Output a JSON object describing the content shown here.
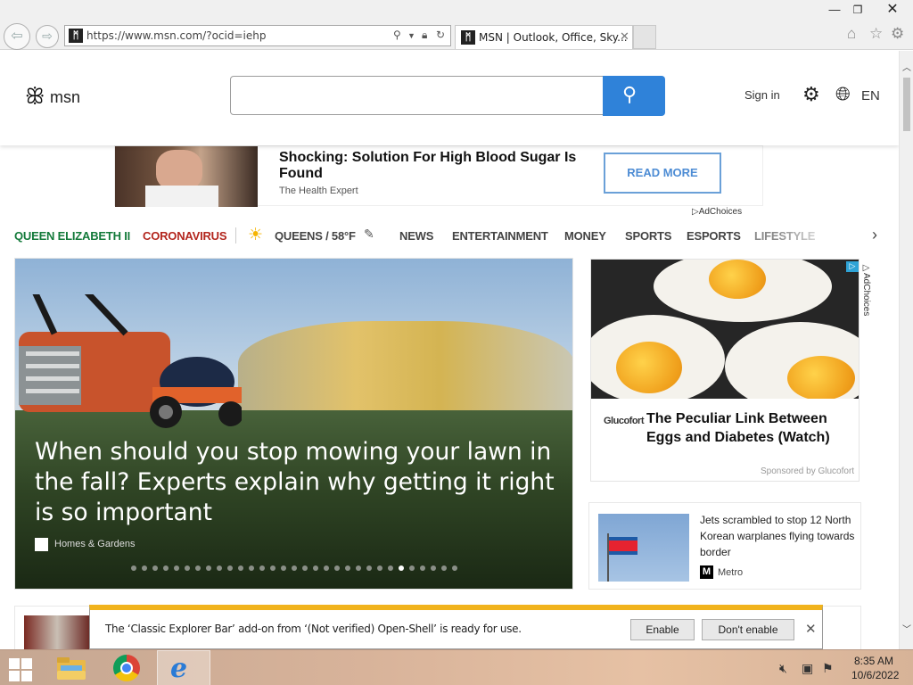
{
  "browser": {
    "address": "https://www.msn.com/?ocid=iehp",
    "tab_title": "MSN | Outlook, Office, Sky...",
    "window_controls": {
      "minimize": "—",
      "restore": "❐",
      "close": "✕"
    }
  },
  "msn_header": {
    "logo_text": "msn",
    "search_placeholder": "",
    "signin_label": "Sign in",
    "language": "EN"
  },
  "top_ad": {
    "headline": "Shocking: Solution For High Blood Sugar Is Found",
    "source": "The Health Expert",
    "cta": "READ MORE",
    "adchoices": "AdChoices"
  },
  "nav": {
    "items": [
      {
        "label": "QUEEN ELIZABETH II",
        "color": "#137a3a"
      },
      {
        "label": "CORONAVIRUS",
        "color": "#b3261e"
      },
      {
        "label": "QUEENS / 58°F"
      },
      {
        "label": "NEWS"
      },
      {
        "label": "ENTERTAINMENT"
      },
      {
        "label": "MONEY"
      },
      {
        "label": "SPORTS"
      },
      {
        "label": "ESPORTS"
      },
      {
        "label": "LIFESTYLE"
      }
    ]
  },
  "hero": {
    "title": "When should you stop mowing your lawn in the fall? Experts explain why getting it right is so important",
    "source": "Homes & Gardens",
    "dot_count": 31,
    "active_dot": 25
  },
  "side_ad": {
    "brand": "Glucofort",
    "headline": "The Peculiar Link Between Eggs and Diabetes (Watch)",
    "sponsor": "Sponsored by Glucofort",
    "adchoices": "AdChoices"
  },
  "news_card": {
    "title": "Jets scrambled to stop 12 North Korean warplanes flying towards border",
    "source": "Metro"
  },
  "notification": {
    "message": "The ‘Classic Explorer Bar’ add-on from ‘(Not verified) Open-Shell’ is ready for use.",
    "enable_label": "Enable",
    "dont_enable_label": "Don't enable"
  },
  "taskbar": {
    "time": "8:35 AM",
    "date": "10/6/2022"
  },
  "colors": {
    "search_button": "#2f82d9",
    "notify_accent": "#f1b31c"
  }
}
